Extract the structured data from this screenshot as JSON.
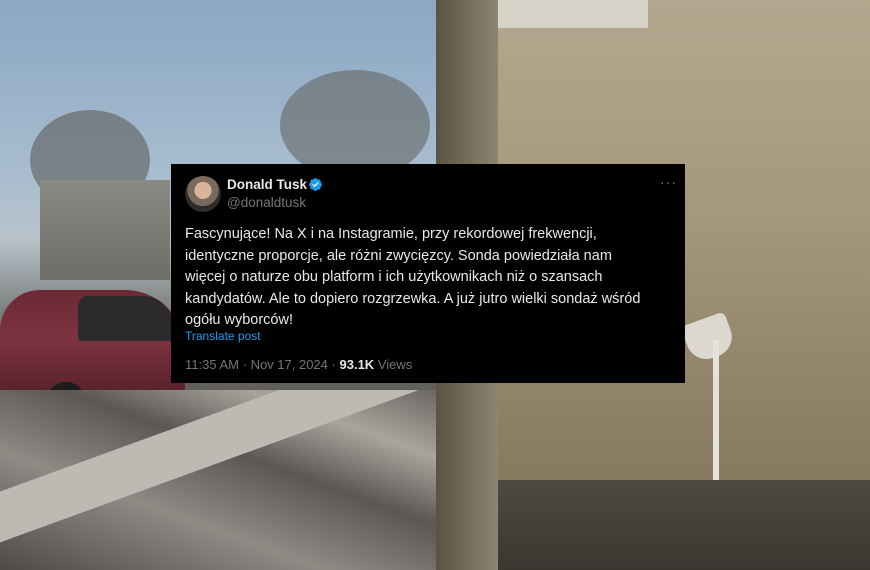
{
  "tweet": {
    "display_name": "Donald Tusk",
    "handle": "@donaldtusk",
    "verified_icon": "verified-badge-icon",
    "more_icon": "more-options-icon",
    "more_glyph": "···",
    "text": "Fascynujące! Na X i na Instagramie, przy rekordowej frekwencji,\nidentyczne proporcje, ale różni zwycięzcy. Sonda powiedziała nam\nwięcej o naturze obu platform i ich użytkownikach niż o szansach\nkandydatów. Ale to dopiero rozgrzewka. A już jutro wielki sondaż wśród\nogółu wyborców!",
    "translate_label": "Translate post",
    "time": "11:35 AM",
    "separator": "·",
    "date": "Nov 17, 2024",
    "views_count": "93.1K",
    "views_label": "Views"
  },
  "colors": {
    "card_background": "#000000",
    "text_primary": "#e7e9ea",
    "text_secondary": "#71767b",
    "link": "#1d9bf0",
    "verified": "#1d9bf0"
  }
}
